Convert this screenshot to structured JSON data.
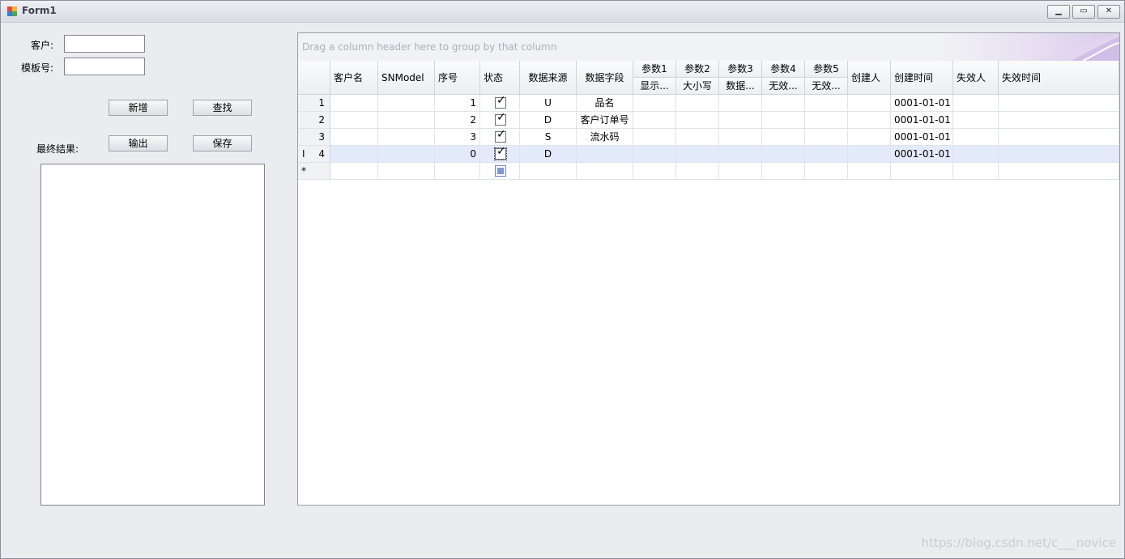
{
  "window": {
    "title": "Form1"
  },
  "form": {
    "customer_label": "客户:",
    "customer_value": "",
    "template_label": "模板号:",
    "template_value": "",
    "add_button": "新增",
    "search_button": "查找",
    "output_button": "输出",
    "save_button": "保存",
    "result_label": "最终结果:",
    "result_value": ""
  },
  "grid": {
    "group_hint": "Drag a column header here to group by that column",
    "columns": {
      "customer": "客户名",
      "snmodel": "SNModel",
      "seq": "序号",
      "status": "状态",
      "source": "数据来源",
      "field": "数据字段",
      "p1": "参数1",
      "p1_sub": "显示...",
      "p2": "参数2",
      "p2_sub": "大小写",
      "p3": "参数3",
      "p3_sub": "数据...",
      "p4": "参数4",
      "p4_sub": "无效...",
      "p5": "参数5",
      "p5_sub": "无效...",
      "creator": "创建人",
      "created": "创建时间",
      "expirer": "失效人",
      "expired": "失效时间"
    },
    "rows": [
      {
        "ind": "1",
        "seq": "1",
        "status": true,
        "source": "U",
        "field": "品名",
        "created": "0001-01-01"
      },
      {
        "ind": "2",
        "seq": "2",
        "status": true,
        "source": "D",
        "field": "客户订单号",
        "created": "0001-01-01"
      },
      {
        "ind": "3",
        "seq": "3",
        "status": true,
        "source": "S",
        "field": "流水码",
        "created": "0001-01-01"
      },
      {
        "ind": "4",
        "seq": "0",
        "status": true,
        "source": "D",
        "field": "",
        "created": "0001-01-01"
      }
    ],
    "new_row_marker": "*",
    "editing_marker": "I"
  },
  "watermark": "https://blog.csdn.net/c___novice"
}
